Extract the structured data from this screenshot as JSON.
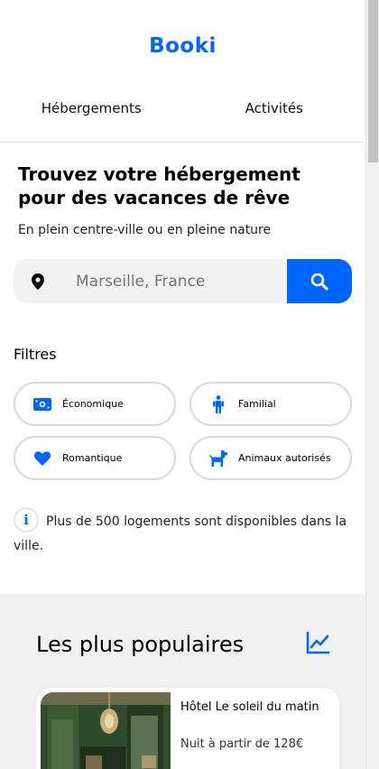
{
  "header": {
    "logo": "Booki",
    "tabs": [
      {
        "label": "Hébergements"
      },
      {
        "label": "Activités"
      }
    ]
  },
  "hero": {
    "title": "Trouvez votre hébergement pour des vacances de rêve",
    "subtitle": "En plein centre-ville ou en pleine nature"
  },
  "search": {
    "placeholder": "Marseille, France",
    "pin_icon": "location-pin-icon",
    "button_icon": "search-icon"
  },
  "filters": {
    "title": "Filtres",
    "items": [
      {
        "label": "Économique",
        "icon": "money-icon"
      },
      {
        "label": "Familial",
        "icon": "child-icon"
      },
      {
        "label": "Romantique",
        "icon": "heart-icon"
      },
      {
        "label": "Animaux autorisés",
        "icon": "dog-icon"
      }
    ]
  },
  "info": {
    "icon": "info-icon",
    "text": "Plus de 500 logements sont disponibles dans la ville."
  },
  "popular": {
    "title": "Les plus populaires",
    "icon": "trend-chart-icon",
    "cards": [
      {
        "name": "Hôtel Le soleil du matin",
        "price": "Nuit à partir de 128€"
      }
    ]
  },
  "colors": {
    "accent": "#0065fc",
    "section_bg": "#f2f2f2",
    "border": "#d9d9d9"
  }
}
